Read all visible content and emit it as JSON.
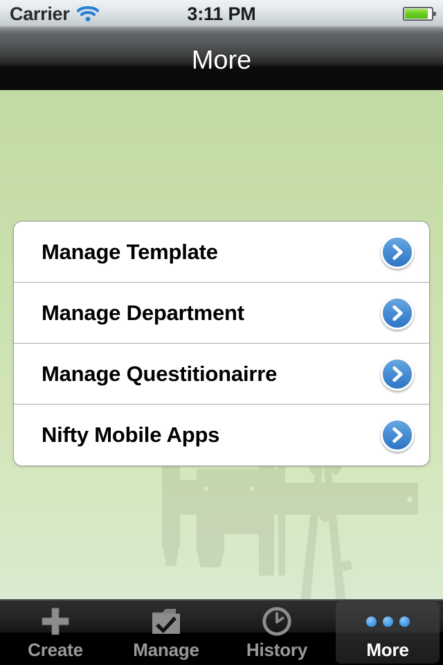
{
  "status_bar": {
    "carrier": "Carrier",
    "wifi_icon": "wifi-icon",
    "time": "3:11 PM",
    "battery_icon": "battery-icon",
    "battery_level_percent": 82,
    "wifi_color": "#2a7fd4",
    "battery_color": "#68cc22"
  },
  "nav_bar": {
    "title": "More"
  },
  "content": {
    "background_color_top": "#c2daa3",
    "background_color_bottom": "#d9ead0",
    "watermark_icon": "drafting-tools-watermark"
  },
  "menu": {
    "items": [
      {
        "label": "Manage Template",
        "chevron_icon": "chevron-right-icon"
      },
      {
        "label": "Manage Department",
        "chevron_icon": "chevron-right-icon"
      },
      {
        "label": "Manage Questitionairre",
        "chevron_icon": "chevron-right-icon"
      },
      {
        "label": "Nifty Mobile Apps",
        "chevron_icon": "chevron-right-icon"
      }
    ],
    "accent_color": "#3f85d2"
  },
  "tab_bar": {
    "tabs": [
      {
        "label": "Create",
        "icon": "plus-icon",
        "selected": false
      },
      {
        "label": "Manage",
        "icon": "folder-check-icon",
        "selected": false
      },
      {
        "label": "History",
        "icon": "clock-icon",
        "selected": false
      },
      {
        "label": "More",
        "icon": "three-dots-icon",
        "selected": true
      }
    ],
    "selected_text_color": "#ffffff",
    "inactive_text_color": "#9a9a9a",
    "dot_color": "#4c9fe8"
  }
}
